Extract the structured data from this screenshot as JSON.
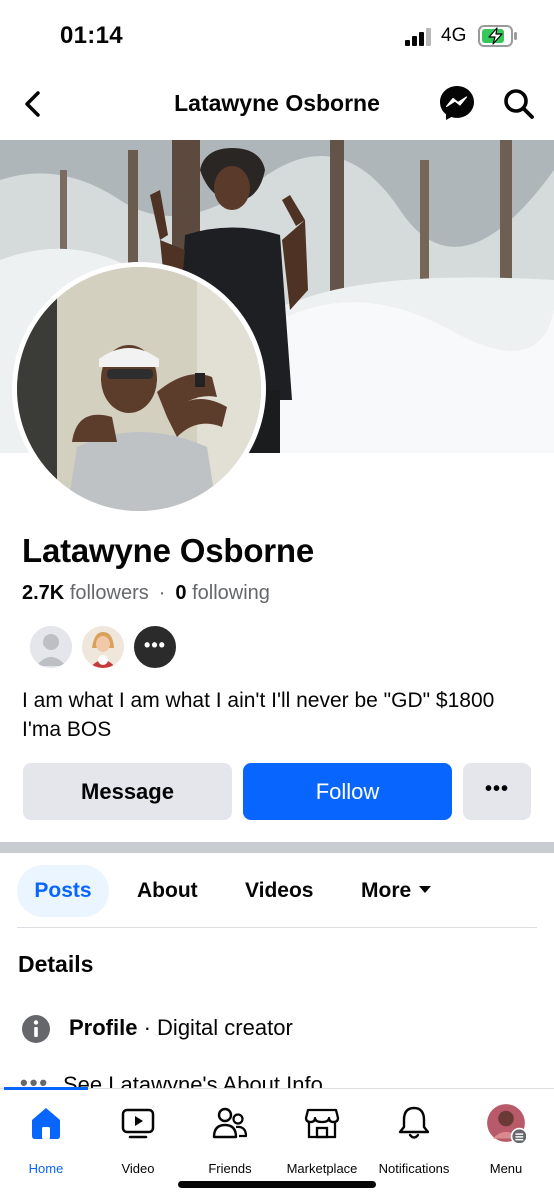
{
  "status": {
    "time": "01:14",
    "network": "4G"
  },
  "nav": {
    "title": "Latawyne Osborne",
    "icons": [
      "back-arrow-icon",
      "messenger-icon",
      "search-icon"
    ]
  },
  "profile": {
    "name": "Latawyne Osborne",
    "followers_count": "2.7K",
    "followers_label": "followers",
    "separator": "·",
    "following_count": "0",
    "following_label": "following",
    "mutual_more": "•••",
    "bio": "I am what I am what I ain't I'll never be  \"GD\" $1800 I'ma BOS"
  },
  "actions": {
    "message": "Message",
    "follow": "Follow",
    "more": "•••"
  },
  "tabs": [
    {
      "label": "Posts",
      "active": true
    },
    {
      "label": "About",
      "active": false
    },
    {
      "label": "Videos",
      "active": false
    },
    {
      "label": "More",
      "active": false
    }
  ],
  "details": {
    "heading": "Details",
    "profile_label": "Profile",
    "profile_separator": "·",
    "profile_value": "Digital creator",
    "see_about": "See Latawyne's About Info"
  },
  "tabbar": [
    {
      "label": "Home",
      "icon": "home-icon",
      "active": true
    },
    {
      "label": "Video",
      "icon": "video-icon",
      "active": false
    },
    {
      "label": "Friends",
      "icon": "friends-icon",
      "active": false
    },
    {
      "label": "Marketplace",
      "icon": "marketplace-icon",
      "active": false
    },
    {
      "label": "Notifications",
      "icon": "bell-icon",
      "active": false
    },
    {
      "label": "Menu",
      "icon": "menu-avatar-icon",
      "active": false
    }
  ],
  "colors": {
    "accent": "#0866ff",
    "button_grey": "#e4e6eb",
    "text_secondary": "#65676b"
  }
}
